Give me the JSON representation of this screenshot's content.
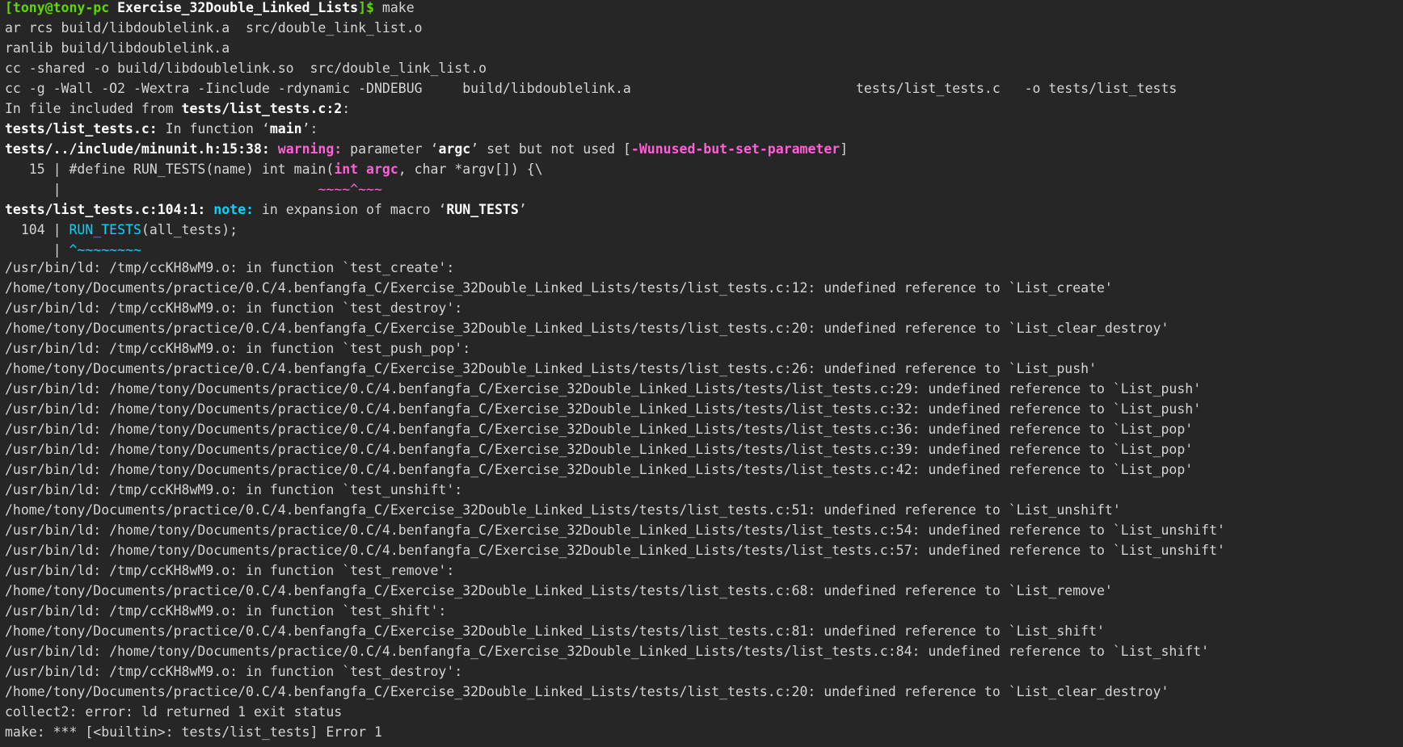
{
  "prompt": {
    "user_host": "[tony@tony-pc",
    "directory": "Exercise_32Double_Linked_Lists",
    "suffix": "]$",
    "command": "make"
  },
  "build_lines": [
    "ar rcs build/libdoublelink.a  src/double_link_list.o",
    "ranlib build/libdoublelink.a",
    "cc -shared -o build/libdoublelink.so  src/double_link_list.o",
    "cc -g -Wall -O2 -Wextra -Iinclude -rdynamic -DNDEBUG     build/libdoublelink.a                            tests/list_tests.c   -o tests/list_tests"
  ],
  "diagnostics": {
    "included_from_prefix": "In file included from ",
    "included_from_file": "tests/list_tests.c:2",
    "included_from_suffix": ":",
    "in_function_file": "tests/list_tests.c:",
    "in_function_text": " In function ‘",
    "in_function_name": "main",
    "in_function_end": "’:",
    "warning_loc": "tests/../include/minunit.h:15:38:",
    "warning_label": "warning:",
    "warning_text_1": " parameter ‘",
    "warning_param": "argc",
    "warning_text_2": "’ set but not used [",
    "warning_flag": "-Wunused-but-set-parameter",
    "warning_text_3": "]",
    "src15_gutter": "   15 | ",
    "src15_pre": "#define RUN_TESTS(name) int main(",
    "src15_hl": "int argc",
    "src15_post": ", char *argv[]) {\\",
    "caret15_gutter": "      | ",
    "caret15_pad": "                               ",
    "caret15_marker": "~~~~^~~~",
    "note_loc": "tests/list_tests.c:104:1:",
    "note_label": "note:",
    "note_text": " in expansion of macro ‘",
    "note_macro": "RUN_TESTS",
    "note_end": "’",
    "src104_gutter": "  104 | ",
    "src104_hl": "RUN_TESTS",
    "src104_post": "(all_tests);",
    "caret104_gutter": "      | ",
    "caret104_marker": "^~~~~~~~~"
  },
  "linker_lines": [
    "/usr/bin/ld: /tmp/ccKH8wM9.o: in function `test_create':",
    "/home/tony/Documents/practice/0.C/4.benfangfa_C/Exercise_32Double_Linked_Lists/tests/list_tests.c:12: undefined reference to `List_create'",
    "/usr/bin/ld: /tmp/ccKH8wM9.o: in function `test_destroy':",
    "/home/tony/Documents/practice/0.C/4.benfangfa_C/Exercise_32Double_Linked_Lists/tests/list_tests.c:20: undefined reference to `List_clear_destroy'",
    "/usr/bin/ld: /tmp/ccKH8wM9.o: in function `test_push_pop':",
    "/home/tony/Documents/practice/0.C/4.benfangfa_C/Exercise_32Double_Linked_Lists/tests/list_tests.c:26: undefined reference to `List_push'",
    "/usr/bin/ld: /home/tony/Documents/practice/0.C/4.benfangfa_C/Exercise_32Double_Linked_Lists/tests/list_tests.c:29: undefined reference to `List_push'",
    "/usr/bin/ld: /home/tony/Documents/practice/0.C/4.benfangfa_C/Exercise_32Double_Linked_Lists/tests/list_tests.c:32: undefined reference to `List_push'",
    "/usr/bin/ld: /home/tony/Documents/practice/0.C/4.benfangfa_C/Exercise_32Double_Linked_Lists/tests/list_tests.c:36: undefined reference to `List_pop'",
    "/usr/bin/ld: /home/tony/Documents/practice/0.C/4.benfangfa_C/Exercise_32Double_Linked_Lists/tests/list_tests.c:39: undefined reference to `List_pop'",
    "/usr/bin/ld: /home/tony/Documents/practice/0.C/4.benfangfa_C/Exercise_32Double_Linked_Lists/tests/list_tests.c:42: undefined reference to `List_pop'",
    "/usr/bin/ld: /tmp/ccKH8wM9.o: in function `test_unshift':",
    "/home/tony/Documents/practice/0.C/4.benfangfa_C/Exercise_32Double_Linked_Lists/tests/list_tests.c:51: undefined reference to `List_unshift'",
    "/usr/bin/ld: /home/tony/Documents/practice/0.C/4.benfangfa_C/Exercise_32Double_Linked_Lists/tests/list_tests.c:54: undefined reference to `List_unshift'",
    "/usr/bin/ld: /home/tony/Documents/practice/0.C/4.benfangfa_C/Exercise_32Double_Linked_Lists/tests/list_tests.c:57: undefined reference to `List_unshift'",
    "/usr/bin/ld: /tmp/ccKH8wM9.o: in function `test_remove':",
    "/home/tony/Documents/practice/0.C/4.benfangfa_C/Exercise_32Double_Linked_Lists/tests/list_tests.c:68: undefined reference to `List_remove'",
    "/usr/bin/ld: /tmp/ccKH8wM9.o: in function `test_shift':",
    "/home/tony/Documents/practice/0.C/4.benfangfa_C/Exercise_32Double_Linked_Lists/tests/list_tests.c:81: undefined reference to `List_shift'",
    "/usr/bin/ld: /home/tony/Documents/practice/0.C/4.benfangfa_C/Exercise_32Double_Linked_Lists/tests/list_tests.c:84: undefined reference to `List_shift'",
    "/usr/bin/ld: /tmp/ccKH8wM9.o: in function `test_destroy':",
    "/home/tony/Documents/practice/0.C/4.benfangfa_C/Exercise_32Double_Linked_Lists/tests/list_tests.c:20: undefined reference to `List_clear_destroy'",
    "collect2: error: ld returned 1 exit status",
    "make: *** [<builtin>: tests/list_tests] Error 1"
  ],
  "colors": {
    "background": "#262626",
    "foreground": "#d4d4d4",
    "prompt_green": "#5fd700",
    "warning_magenta": "#ff5fd7",
    "note_cyan": "#00d7ff"
  }
}
